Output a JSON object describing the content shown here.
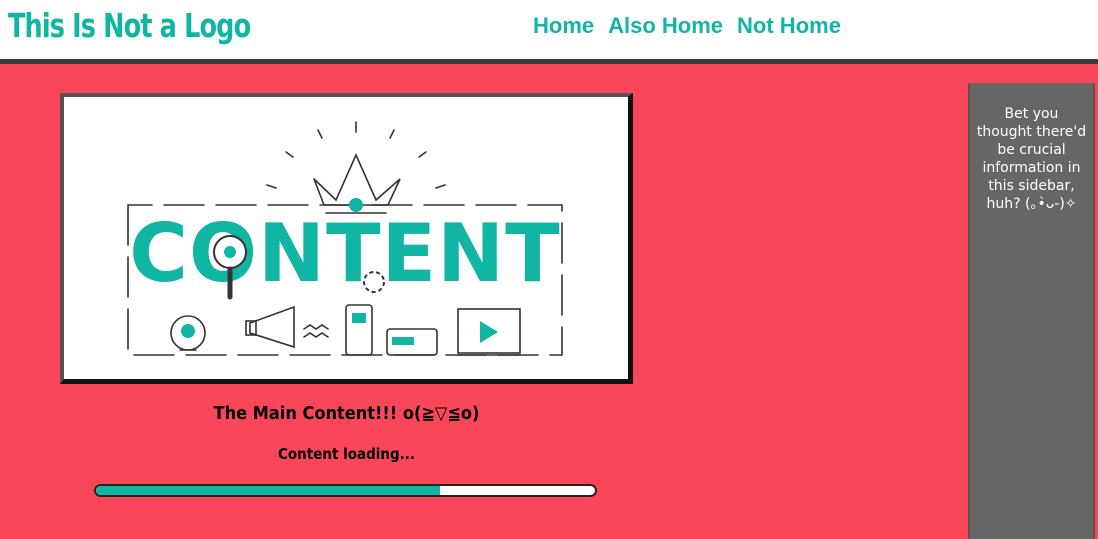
{
  "header": {
    "logo": "This Is Not a Logo",
    "nav": [
      {
        "label": "Home"
      },
      {
        "label": "Also Home"
      },
      {
        "label": "Not Home"
      }
    ]
  },
  "hero": {
    "image_text": "CONTENT"
  },
  "main": {
    "title": "The Main Content!!! o(≧▽≦o)",
    "loading_text": "Content loading...",
    "progress_fraction": 0.69
  },
  "sidebar": {
    "text": "Bet you thought there'd be crucial information in this sidebar, huh? (｡•̀ᴗ-)✧"
  },
  "colors": {
    "accent": "#11b5a4",
    "background": "#fa4659",
    "sidebar": "#666666",
    "header_border": "#3b3b3b"
  }
}
